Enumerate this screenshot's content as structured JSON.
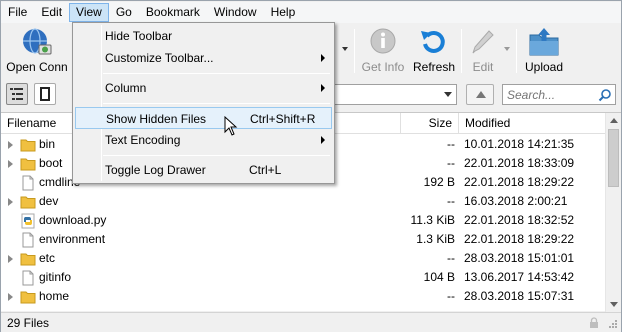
{
  "menubar": {
    "items": [
      "File",
      "Edit",
      "View",
      "Go",
      "Bookmark",
      "Window",
      "Help"
    ],
    "active_index": 2,
    "overflow_glyph": "»"
  },
  "toolbar": {
    "open_connection_label": "Open Conn",
    "get_info_label": "Get Info",
    "refresh_label": "Refresh",
    "edit_label": "Edit",
    "upload_label": "Upload"
  },
  "search": {
    "placeholder": "Search..."
  },
  "table": {
    "columns": {
      "filename": "Filename",
      "size": "Size",
      "modified": "Modified"
    },
    "rows": [
      {
        "name": "bin",
        "size": "--",
        "modified": "10.01.2018 14:21:35",
        "type": "folder",
        "expandable": true
      },
      {
        "name": "boot",
        "size": "--",
        "modified": "22.01.2018 18:33:09",
        "type": "folder",
        "expandable": true
      },
      {
        "name": "cmdline",
        "size": "192 B",
        "modified": "22.01.2018 18:29:22",
        "type": "file",
        "expandable": false
      },
      {
        "name": "dev",
        "size": "--",
        "modified": "16.03.2018 2:00:21",
        "type": "folder",
        "expandable": true
      },
      {
        "name": "download.py",
        "size": "11.3 KiB",
        "modified": "22.01.2018 18:32:52",
        "type": "python",
        "expandable": false
      },
      {
        "name": "environment",
        "size": "1.3 KiB",
        "modified": "22.01.2018 18:29:22",
        "type": "file",
        "expandable": false
      },
      {
        "name": "etc",
        "size": "--",
        "modified": "28.03.2018 15:01:01",
        "type": "folder",
        "expandable": true
      },
      {
        "name": "gitinfo",
        "size": "104 B",
        "modified": "13.06.2017 14:53:42",
        "type": "file",
        "expandable": false
      },
      {
        "name": "home",
        "size": "--",
        "modified": "28.03.2018 15:07:31",
        "type": "folder",
        "expandable": true
      }
    ]
  },
  "status": {
    "text": "29 Files"
  },
  "view_menu": {
    "items": [
      {
        "label": "Hide Toolbar",
        "shortcut": "",
        "submenu": false
      },
      {
        "label": "Customize Toolbar...",
        "shortcut": "",
        "submenu": true
      },
      {
        "label": "Column",
        "shortcut": "",
        "submenu": true
      },
      {
        "label": "Show Hidden Files",
        "shortcut": "Ctrl+Shift+R",
        "submenu": false
      },
      {
        "label": "Text Encoding",
        "shortcut": "",
        "submenu": true
      },
      {
        "label": "Toggle Log Drawer",
        "shortcut": "Ctrl+L",
        "submenu": false
      }
    ],
    "highlighted_index": 3
  },
  "colors": {
    "folder": "#f0c040",
    "accent_blue": "#1a7fd6",
    "menu_highlight": "#e5f1fb"
  },
  "icons": {
    "open_connection": "globe-network-icon",
    "get_info": "info-icon",
    "refresh": "refresh-arrow-icon",
    "edit": "pencil-icon",
    "upload": "upload-folder-icon",
    "search": "magnifier-icon"
  }
}
